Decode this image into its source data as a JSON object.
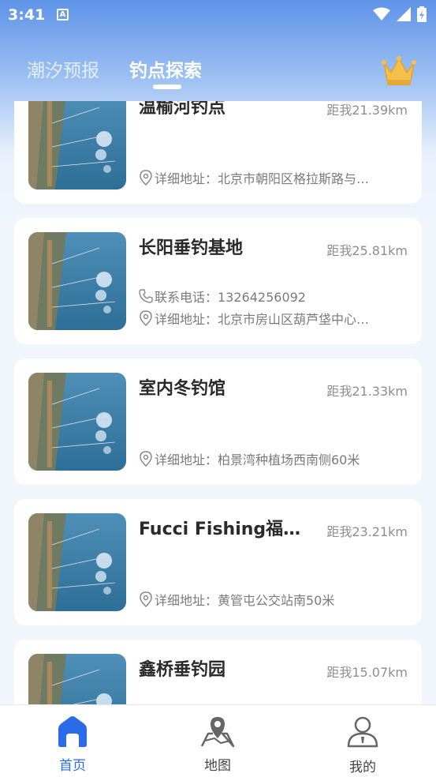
{
  "status_bar": {
    "time": "3:41",
    "notification_icon": "A"
  },
  "tabs": {
    "tide_forecast": "潮汐预报",
    "spot_explore": "钓点探索"
  },
  "icons": {
    "crown": "crown-icon",
    "phone": "phone-icon",
    "location": "location-pin-icon",
    "home": "home-icon",
    "map": "map-icon",
    "profile": "user-icon"
  },
  "spots": [
    {
      "name": "温榆河钓点",
      "distance": "距我21.39km",
      "address": "详细地址：北京市朝阳区格拉斯路与…"
    },
    {
      "name": "长阳垂钓基地",
      "distance": "距我25.81km",
      "phone": "联系电话：13264256092",
      "address": "详细地址：北京市房山区葫芦垡中心…"
    },
    {
      "name": "室内冬钓馆",
      "distance": "距我21.33km",
      "address": "详细地址：柏景湾种植场西南侧60米"
    },
    {
      "name": "Fucci Fishing福羲…",
      "distance": "距我23.21km",
      "address": "详细地址：黄管屯公交站南50米"
    },
    {
      "name": "鑫桥垂钓园",
      "distance": "距我15.07km"
    }
  ],
  "bottom_nav": {
    "home": "首页",
    "map": "地图",
    "mine": "我的"
  },
  "colors": {
    "accent": "#2a6be8",
    "header_gradient_top": "#5e93e8",
    "page_bg": "#f1f6fd",
    "crown": "#f2b53a"
  }
}
